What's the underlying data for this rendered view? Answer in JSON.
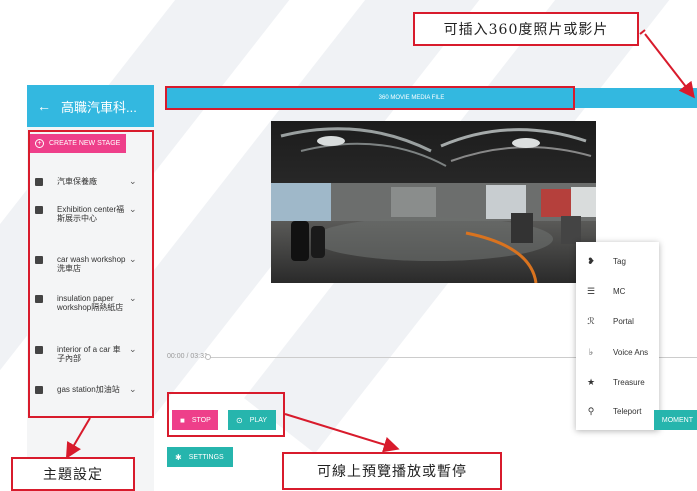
{
  "annotations": {
    "top_right": "可插入360度照片或影片",
    "bottom_left": "主題設定",
    "bottom_center": "可線上預覽播放或暫停"
  },
  "sidebar": {
    "back_icon": "arrow-left-icon",
    "title": "高職汽車科...",
    "create_label": "CREATE NEW STAGE",
    "items": [
      {
        "label": "汽車保養廠",
        "icon": "image-icon"
      },
      {
        "label": "Exhibition center福斯展示中心",
        "icon": "image-icon"
      },
      {
        "label": "car wash workshop洗車店",
        "icon": "image-icon"
      },
      {
        "label": "insulation paper workshop隔熱紙店",
        "icon": "image-icon"
      },
      {
        "label": "interior of a car 車子內部",
        "icon": "image-icon"
      },
      {
        "label": "gas station加油站",
        "icon": "image-icon"
      }
    ]
  },
  "main": {
    "topbar_label": "360 MOVIE MEDIA FILE",
    "time": "00:00 / 03:31",
    "stop_label": "STOP",
    "play_label": "PLAY",
    "settings_label": "SETTINGS",
    "moment_label": "MOMENT"
  },
  "context_menu": [
    {
      "label": "Tag",
      "icon": "tag-icon"
    },
    {
      "label": "MC",
      "icon": "list-icon"
    },
    {
      "label": "Portal",
      "icon": "walk-icon"
    },
    {
      "label": "Voice Ans",
      "icon": "mic-icon"
    },
    {
      "label": "Treasure",
      "icon": "star-icon"
    },
    {
      "label": "Teleport",
      "icon": "pin-icon"
    }
  ],
  "colors": {
    "accent_blue": "#33b8e0",
    "pink": "#ee3f8a",
    "teal": "#26b5ad",
    "annotation_red": "#d81b2c"
  }
}
